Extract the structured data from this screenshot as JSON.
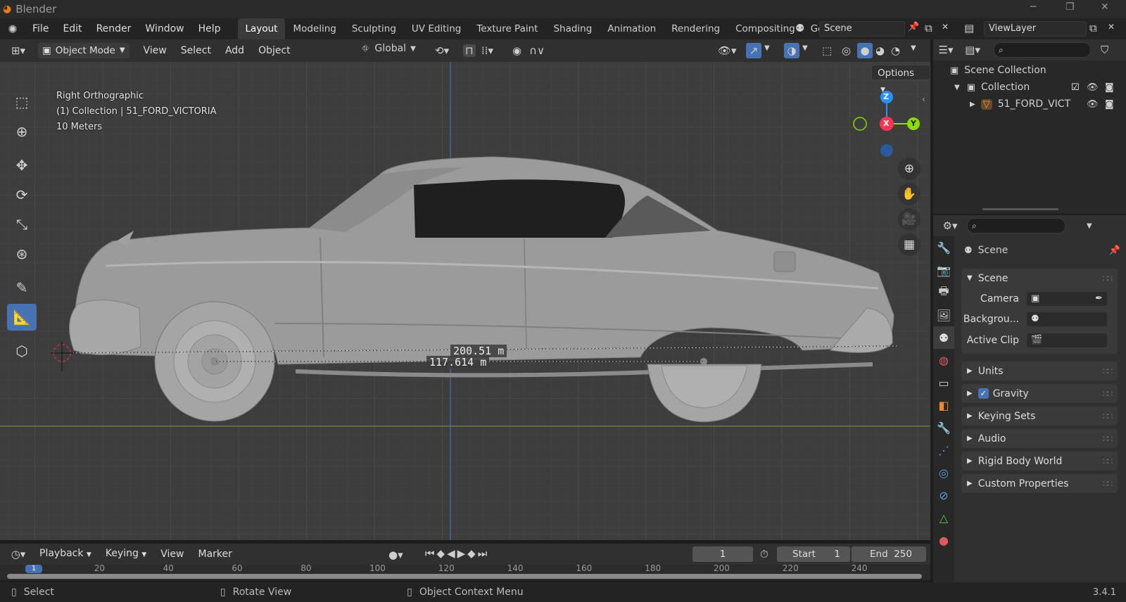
{
  "titlebar": {
    "title": "Blender",
    "minimize": "─",
    "maximize": "❐",
    "close": "✕"
  },
  "menu": [
    "File",
    "Edit",
    "Render",
    "Window",
    "Help"
  ],
  "workspaces": [
    "Layout",
    "Modeling",
    "Sculpting",
    "UV Editing",
    "Texture Paint",
    "Shading",
    "Animation",
    "Rendering",
    "Compositing",
    "Geo"
  ],
  "scene": {
    "name": "Scene",
    "viewlayer": "ViewLayer"
  },
  "vpheader": {
    "mode": "Object Mode",
    "menus": [
      "View",
      "Select",
      "Add",
      "Object"
    ],
    "orientation": "Global"
  },
  "viewport": {
    "options": "Options",
    "view_name": "Right Orthographic",
    "collection_line": "(1) Collection | 51_FORD_VICTORIA",
    "scale": "10 Meters",
    "measure1": "200.51 m",
    "measure2": "117.614 m",
    "gizmo": {
      "z": "Z",
      "x": "X",
      "y": "Y"
    }
  },
  "timeline": {
    "menus": [
      "Playback",
      "Keying",
      "View",
      "Marker"
    ],
    "current_frame": "1",
    "start_label": "Start",
    "start": "1",
    "end_label": "End",
    "end": "250",
    "ticks": [
      "1",
      "20",
      "40",
      "60",
      "80",
      "100",
      "120",
      "140",
      "160",
      "180",
      "200",
      "220",
      "240"
    ]
  },
  "statusbar": {
    "left": "Select",
    "middle": "Rotate View",
    "right": "Object Context Menu",
    "version": "3.4.1"
  },
  "outliner": {
    "root": "Scene Collection",
    "collection": "Collection",
    "object": "51_FORD_VICT"
  },
  "properties": {
    "header": "Scene",
    "panel_scene": "Scene",
    "camera_label": "Camera",
    "background_label": "Backgrou...",
    "clip_label": "Active Clip",
    "panels": [
      "Units",
      "Gravity",
      "Keying Sets",
      "Audio",
      "Rigid Body World",
      "Custom Properties"
    ]
  },
  "colors": {
    "accent": "#4772b3",
    "axis_x": "#ff3352",
    "axis_y": "#8bdc00",
    "axis_z": "#2890ff",
    "viewport_bg": "#3d3d3d"
  }
}
